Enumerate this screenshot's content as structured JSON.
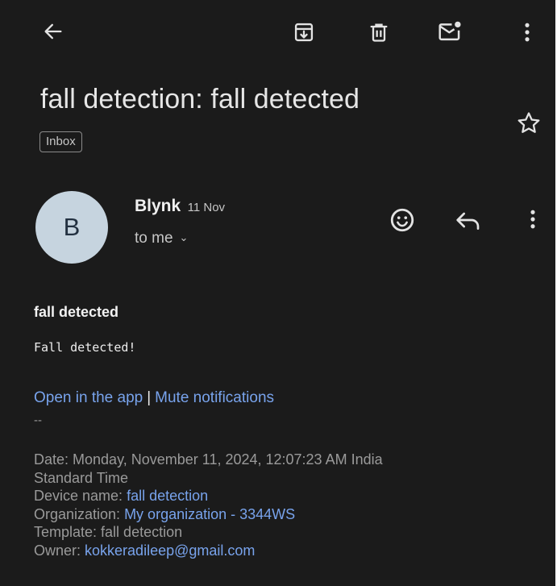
{
  "toolbar": {
    "back_icon": "arrow-left-icon",
    "archive_icon": "archive-icon",
    "delete_icon": "trash-icon",
    "mark_unread_icon": "mark-unread-icon",
    "more_icon": "more-vert-icon"
  },
  "email": {
    "subject": "fall detection: fall detected",
    "label": "Inbox",
    "star_icon": "star-outline-icon"
  },
  "sender": {
    "avatar_letter": "B",
    "name": "Blynk",
    "date": "11 Nov",
    "recipient": "to me",
    "recipient_chevron": "⌄",
    "react_icon": "emoji-icon",
    "reply_icon": "reply-icon",
    "more_icon": "more-vert-icon"
  },
  "body": {
    "heading": "fall detected",
    "message": "Fall detected!",
    "link_open": "Open in the app",
    "link_separator": "|",
    "link_mute": "Mute notifications",
    "signature_dash": "--",
    "date_label": "Date: ",
    "date_value": "Monday, November 11, 2024, 12:07:23 AM India",
    "date_value_cont": "Standard Time",
    "device_label": "Device name: ",
    "device_value": "fall detection",
    "org_label": "Organization: ",
    "org_value": "My organization - 3344WS",
    "template_label": "Template: ",
    "template_value": "fall detection",
    "owner_label": "Owner: ",
    "owner_value": "kokkeradileep@gmail.com"
  },
  "colors": {
    "background": "#1b1b1b",
    "text_primary": "#e6e6e6",
    "text_secondary": "#9a9a9a",
    "link": "#78a3ec",
    "avatar_bg": "#c6d4df"
  }
}
